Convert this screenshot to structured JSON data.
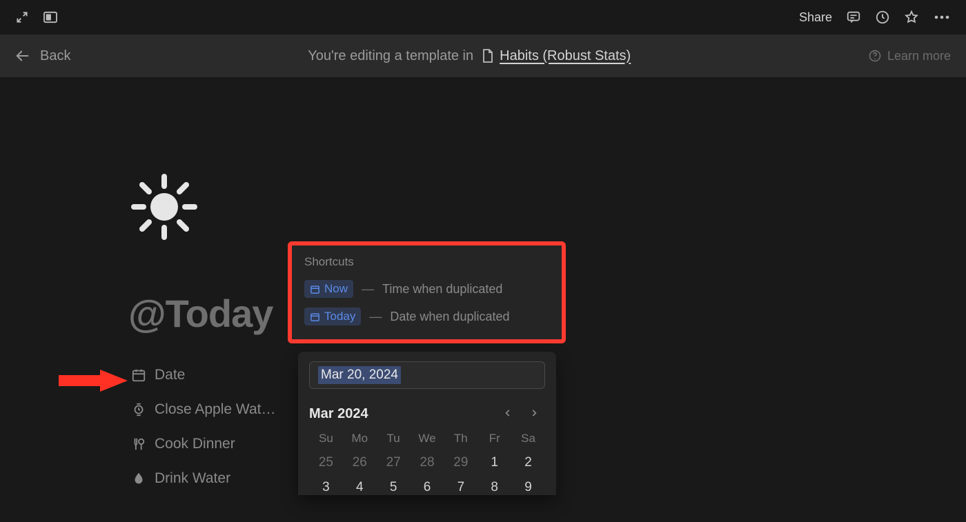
{
  "topbar": {
    "share_label": "Share"
  },
  "banner": {
    "back_label": "Back",
    "msg": "You're editing a template in",
    "doc_title": "Habits (Robust Stats)",
    "learn_more": "Learn more"
  },
  "page": {
    "title_text": "@Today"
  },
  "properties": [
    {
      "icon": "calendar-icon",
      "label": "Date"
    },
    {
      "icon": "watch-icon",
      "label": "Close Apple Wat…"
    },
    {
      "icon": "utensils-icon",
      "label": "Cook Dinner"
    },
    {
      "icon": "drop-icon",
      "label": "Drink Water"
    }
  ],
  "shortcuts": {
    "heading": "Shortcuts",
    "rows": [
      {
        "pill_label": "Now",
        "desc": "Time when duplicated"
      },
      {
        "pill_label": "Today",
        "desc": "Date when duplicated"
      }
    ],
    "dash": "—"
  },
  "datepicker": {
    "input_value": "Mar 20, 2024",
    "month_label": "Mar 2024",
    "dow": [
      "Su",
      "Mo",
      "Tu",
      "We",
      "Th",
      "Fr",
      "Sa"
    ],
    "leading_prev": [
      "25",
      "26",
      "27",
      "28",
      "29"
    ],
    "days_in_month_visible": [
      "1",
      "2",
      "3",
      "4",
      "5",
      "6",
      "7",
      "8",
      "9"
    ]
  },
  "colors": {
    "accent_red": "#ff3b30",
    "link_blue": "#5b8ae6"
  }
}
